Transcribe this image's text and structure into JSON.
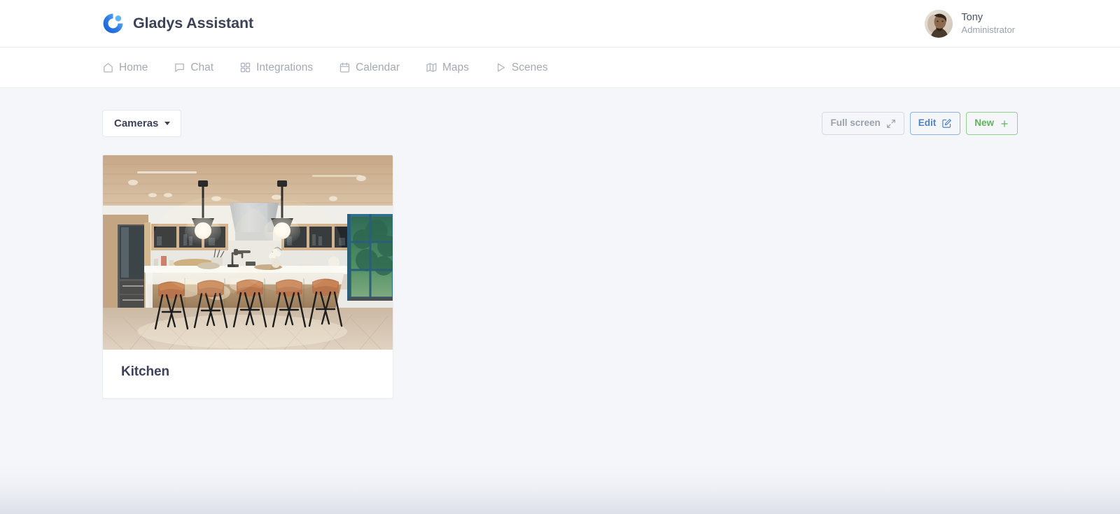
{
  "header": {
    "brand_name": "Gladys Assistant",
    "logo_icon": "gladys-ring-logo",
    "user": {
      "name": "Tony",
      "role": "Administrator",
      "avatar_icon": "user-avatar-photo"
    }
  },
  "nav": {
    "items": [
      {
        "label": "Home",
        "icon": "home-icon"
      },
      {
        "label": "Chat",
        "icon": "chat-bubble-icon"
      },
      {
        "label": "Integrations",
        "icon": "grid-squares-icon"
      },
      {
        "label": "Calendar",
        "icon": "calendar-icon"
      },
      {
        "label": "Maps",
        "icon": "map-icon"
      },
      {
        "label": "Scenes",
        "icon": "play-triangle-icon"
      }
    ]
  },
  "toolbar": {
    "dashboard_selector": "Cameras",
    "dashboard_selector_icon": "caret-down-icon",
    "fullscreen_label": "Full screen",
    "fullscreen_icon": "expand-arrows-icon",
    "edit_label": "Edit",
    "edit_icon": "pencil-square-icon",
    "new_label": "New",
    "new_icon": "plus-icon"
  },
  "cameras": [
    {
      "title": "Kitchen",
      "image_alt": "modern kitchen with island, five leather bar stools and two pendant lights"
    }
  ],
  "colors": {
    "page_background": "#f5f6fa",
    "surface": "#ffffff",
    "text_primary": "#3c4257",
    "text_muted": "#9aa1ad",
    "nav_text": "#a4aab4",
    "accent_blue": "#4b82c4",
    "accent_green": "#61b35b",
    "border": "#e9ecef",
    "logo_blue_light": "#5aa8f0",
    "logo_blue_dark": "#1c62d6"
  }
}
